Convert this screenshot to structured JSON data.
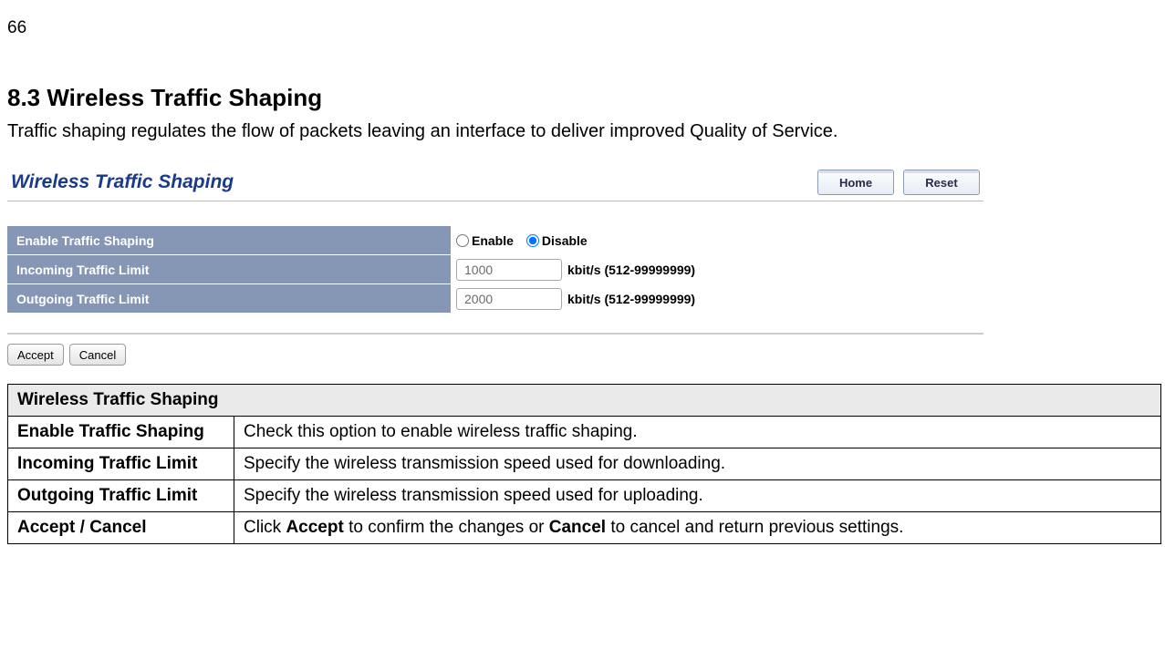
{
  "page_number": "66",
  "heading": "8.3   Wireless Traffic Shaping",
  "intro": "Traffic shaping regulates the flow of packets leaving an interface to deliver improved Quality of Service.",
  "screenshot": {
    "title": "Wireless Traffic Shaping",
    "nav": {
      "home": "Home",
      "reset": "Reset"
    },
    "rows": {
      "enable": {
        "label": "Enable Traffic Shaping",
        "opt_enable": "Enable",
        "opt_disable": "Disable",
        "selected": "disable"
      },
      "incoming": {
        "label": "Incoming Traffic Limit",
        "value": "1000",
        "suffix": "kbit/s (512-99999999)"
      },
      "outgoing": {
        "label": "Outgoing Traffic Limit",
        "value": "2000",
        "suffix": "kbit/s (512-99999999)"
      }
    },
    "actions": {
      "accept": "Accept",
      "cancel": "Cancel"
    }
  },
  "desc": {
    "header": "Wireless Traffic Shaping",
    "rows": [
      {
        "k": "Enable Traffic Shaping",
        "v_plain": "Check this option to enable wireless traffic shaping."
      },
      {
        "k": "Incoming Traffic Limit",
        "v_plain": "Specify the wireless transmission speed used for downloading."
      },
      {
        "k": "Outgoing Traffic Limit",
        "v_plain": "Specify the wireless transmission speed used for uploading."
      },
      {
        "k": "Accept / Cancel",
        "v_pre": "Click ",
        "v_b1": "Accept",
        "v_mid": " to confirm the changes or ",
        "v_b2": "Cancel",
        "v_post": " to cancel and return previous settings."
      }
    ]
  }
}
